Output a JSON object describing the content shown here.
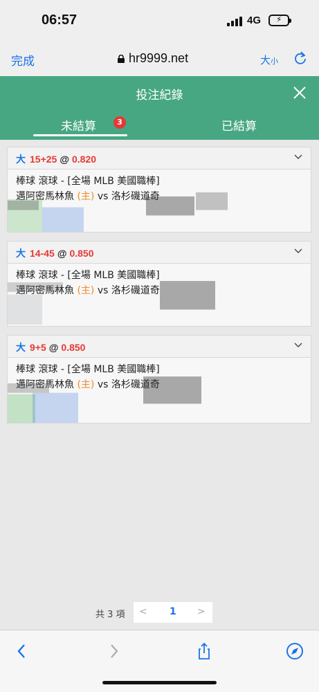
{
  "status": {
    "time": "06:57",
    "network": "4G"
  },
  "browser": {
    "done_label": "完成",
    "url": "hr9999.net",
    "text_size_big": "大",
    "text_size_small": "小"
  },
  "header": {
    "title": "投注紀錄"
  },
  "tabs": {
    "pending_label": "未結算",
    "pending_count": "3",
    "settled_label": "已結算"
  },
  "bets": [
    {
      "type": "大",
      "handicap": "15+25",
      "at": "@",
      "odds": "0.820",
      "league": "棒球 滾球 - [全場 MLB 美國職棒]",
      "home_team": "邁阿密馬林魚",
      "home_tag": "(主)",
      "vs": "vs",
      "away_team": "洛杉磯道奇"
    },
    {
      "type": "大",
      "handicap": "14-45",
      "at": "@",
      "odds": "0.850",
      "league": "棒球 滾球 - [全場 MLB 美國職棒]",
      "home_team": "邁阿密馬林魚",
      "home_tag": "(主)",
      "vs": "vs",
      "away_team": "洛杉磯道奇"
    },
    {
      "type": "大",
      "handicap": "9+5",
      "at": "@",
      "odds": "0.850",
      "league": "棒球 滾球 - [全場 MLB 美國職棒]",
      "home_team": "邁阿密馬林魚",
      "home_tag": "(主)",
      "vs": "vs",
      "away_team": "洛杉磯道奇"
    }
  ],
  "pagination": {
    "total": "共 3 項",
    "prev": "<",
    "current": "1",
    "next": ">"
  },
  "colors": {
    "header_green": "#47a783",
    "accent_blue": "#1a73e8",
    "odds_red": "#e53935",
    "home_orange": "#f08a24"
  }
}
